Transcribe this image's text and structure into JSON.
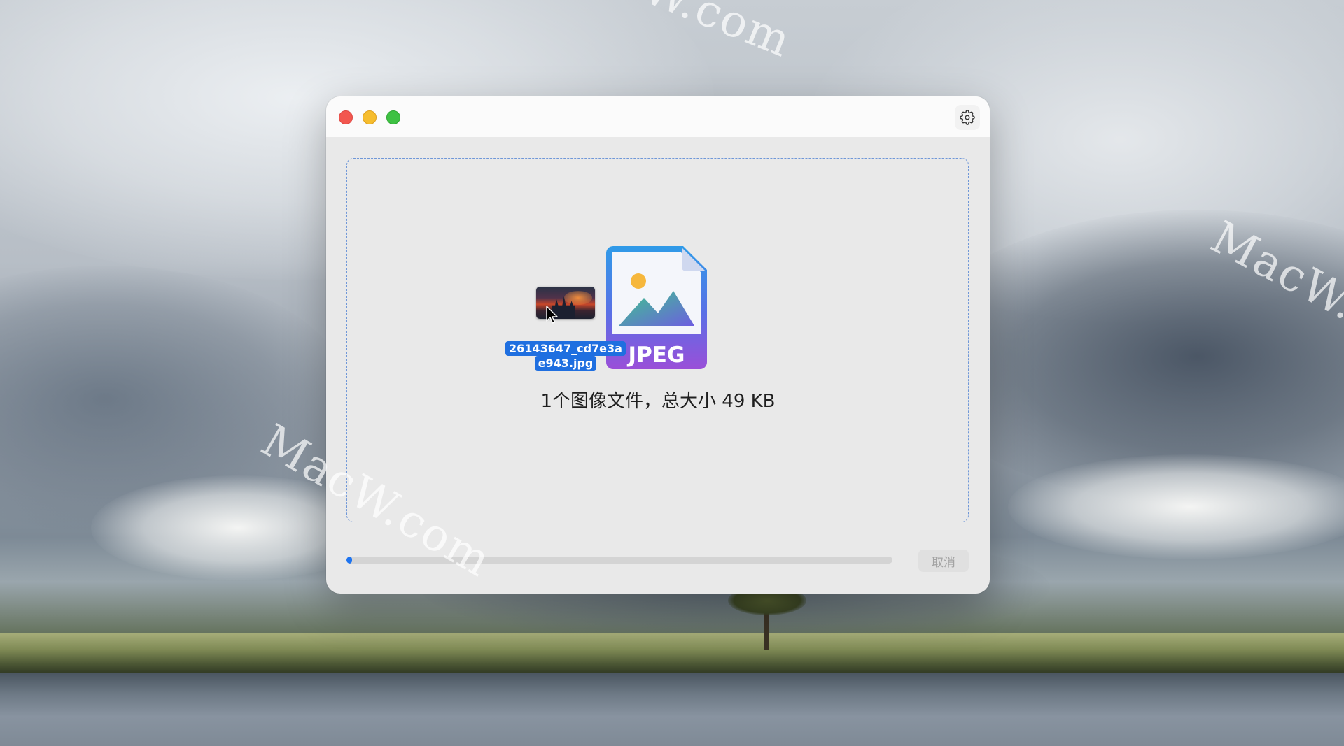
{
  "desktop": {
    "watermarks": [
      "acW.com",
      "MacW.c",
      "MacW.com"
    ]
  },
  "window": {
    "traffic_lights": {
      "close": "#f2574f",
      "minimize": "#f6bd2e",
      "maximize": "#3ec143"
    },
    "settings_icon": "gear-icon"
  },
  "drop_zone": {
    "dragged_file": {
      "name_line1": "26143647_cd7e3a",
      "name_line2": "e943.jpg"
    },
    "format_icon": {
      "icon": "image-file-icon",
      "label": "JPEG"
    },
    "summary": "1个图像文件，总大小 49 KB"
  },
  "progress": {
    "value": 0.008
  },
  "cancel_label": "取消",
  "colors": {
    "accent": "#1e74f0",
    "dashed_border": "#6f97d8"
  }
}
